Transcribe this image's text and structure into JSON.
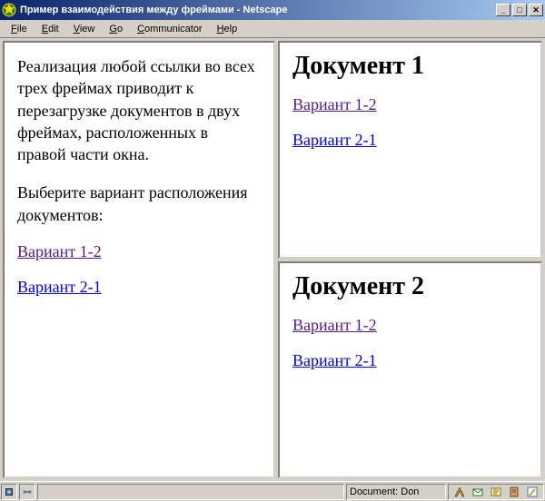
{
  "window": {
    "title": "Пример взаимодействия между фреймами - Netscape"
  },
  "menu": {
    "file": "File",
    "edit": "Edit",
    "view": "View",
    "go": "Go",
    "communicator": "Communicator",
    "help": "Help"
  },
  "left_frame": {
    "para1": "Реализация любой ссылки во всех трех фреймах приводит к перезагрузке документов в двух фреймах, расположенных в правой части окна.",
    "para2": "Выберите вариант расположения документов:",
    "link1": "Вариант 1-2",
    "link2": "Вариант 2-1"
  },
  "top_right_frame": {
    "heading": "Документ 1",
    "link1": "Вариант 1-2",
    "link2": "Вариант 2-1"
  },
  "bottom_right_frame": {
    "heading": "Документ 2",
    "link1": "Вариант 1-2",
    "link2": "Вариант 2-1"
  },
  "statusbar": {
    "doc": "Document: Don"
  }
}
